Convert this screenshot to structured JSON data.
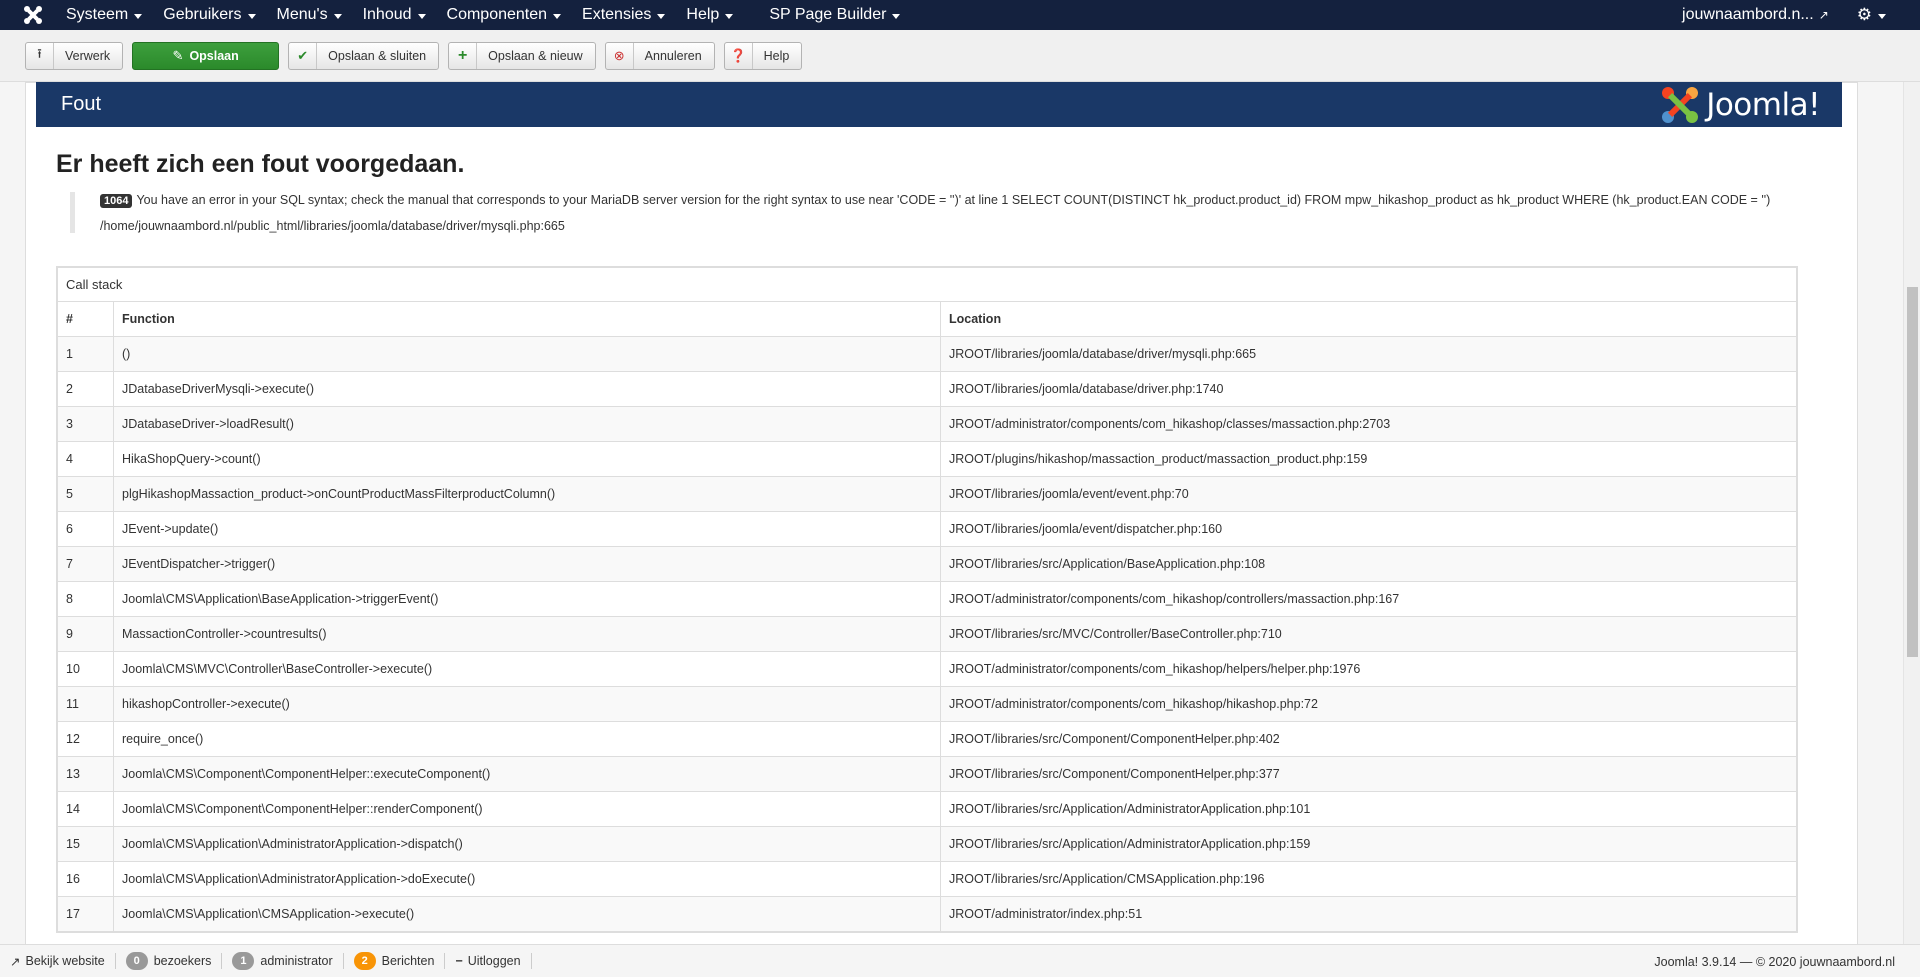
{
  "navbar": {
    "menu": [
      {
        "label": "Systeem"
      },
      {
        "label": "Gebruikers"
      },
      {
        "label": "Menu's"
      },
      {
        "label": "Inhoud"
      },
      {
        "label": "Componenten"
      },
      {
        "label": "Extensies"
      },
      {
        "label": "Help"
      },
      {
        "label": "SP Page Builder"
      }
    ],
    "site_link": "jouwnaambord.n...",
    "icons": {
      "logo": "joomla-logo-icon",
      "external": "external-link-icon",
      "settings": "gear-icon"
    }
  },
  "toolbar": {
    "buttons": [
      {
        "label": "Verwerk",
        "icon": "upload-icon"
      },
      {
        "label": "Opslaan",
        "icon": "edit-icon"
      },
      {
        "label": "Opslaan & sluiten",
        "icon": "check-icon"
      },
      {
        "label": "Opslaan & nieuw",
        "icon": "plus-icon"
      },
      {
        "label": "Annuleren",
        "icon": "cancel-icon"
      },
      {
        "label": "Help",
        "icon": "question-icon"
      }
    ],
    "colors": {
      "save_green": "#2b8a2b",
      "cancel_red": "#cc3333"
    }
  },
  "error": {
    "header_title": "Fout",
    "brand": "Joomla!",
    "heading": "Er heeft zich een fout voorgedaan.",
    "code": "1064",
    "message": "You have an error in your SQL syntax; check the manual that corresponds to your MariaDB server version for the right syntax to use near 'CODE = '')' at line 1 SELECT COUNT(DISTINCT hk_product.product_id) FROM mpw_hikashop_product as hk_product WHERE (hk_product.EAN CODE = '')",
    "path": "/home/jouwnaambord.nl/public_html/libraries/joomla/database/driver/mysqli.php:665",
    "header_color": "#1a3867"
  },
  "call_stack": {
    "caption": "Call stack",
    "headers": {
      "num": "#",
      "function": "Function",
      "location": "Location"
    },
    "rows": [
      {
        "num": "1",
        "function": "()",
        "location": "JROOT/libraries/joomla/database/driver/mysqli.php:665"
      },
      {
        "num": "2",
        "function": "JDatabaseDriverMysqli->execute()",
        "location": "JROOT/libraries/joomla/database/driver.php:1740"
      },
      {
        "num": "3",
        "function": "JDatabaseDriver->loadResult()",
        "location": "JROOT/administrator/components/com_hikashop/classes/massaction.php:2703"
      },
      {
        "num": "4",
        "function": "HikaShopQuery->count()",
        "location": "JROOT/plugins/hikashop/massaction_product/massaction_product.php:159"
      },
      {
        "num": "5",
        "function": "plgHikashopMassaction_product->onCountProductMassFilterproductColumn()",
        "location": "JROOT/libraries/joomla/event/event.php:70"
      },
      {
        "num": "6",
        "function": "JEvent->update()",
        "location": "JROOT/libraries/joomla/event/dispatcher.php:160"
      },
      {
        "num": "7",
        "function": "JEventDispatcher->trigger()",
        "location": "JROOT/libraries/src/Application/BaseApplication.php:108"
      },
      {
        "num": "8",
        "function": "Joomla\\CMS\\Application\\BaseApplication->triggerEvent()",
        "location": "JROOT/administrator/components/com_hikashop/controllers/massaction.php:167"
      },
      {
        "num": "9",
        "function": "MassactionController->countresults()",
        "location": "JROOT/libraries/src/MVC/Controller/BaseController.php:710"
      },
      {
        "num": "10",
        "function": "Joomla\\CMS\\MVC\\Controller\\BaseController->execute()",
        "location": "JROOT/administrator/components/com_hikashop/helpers/helper.php:1976"
      },
      {
        "num": "11",
        "function": "hikashopController->execute()",
        "location": "JROOT/administrator/components/com_hikashop/hikashop.php:72"
      },
      {
        "num": "12",
        "function": "require_once()",
        "location": "JROOT/libraries/src/Component/ComponentHelper.php:402"
      },
      {
        "num": "13",
        "function": "Joomla\\CMS\\Component\\ComponentHelper::executeComponent()",
        "location": "JROOT/libraries/src/Component/ComponentHelper.php:377"
      },
      {
        "num": "14",
        "function": "Joomla\\CMS\\Component\\ComponentHelper::renderComponent()",
        "location": "JROOT/libraries/src/Application/AdministratorApplication.php:101"
      },
      {
        "num": "15",
        "function": "Joomla\\CMS\\Application\\AdministratorApplication->dispatch()",
        "location": "JROOT/libraries/src/Application/AdministratorApplication.php:159"
      },
      {
        "num": "16",
        "function": "Joomla\\CMS\\Application\\AdministratorApplication->doExecute()",
        "location": "JROOT/libraries/src/Application/CMSApplication.php:196"
      },
      {
        "num": "17",
        "function": "Joomla\\CMS\\Application\\CMSApplication->execute()",
        "location": "JROOT/administrator/index.php:51"
      }
    ]
  },
  "status_bar": {
    "view_site": "Bekijk website",
    "visitors_count": "0",
    "visitors_label": "bezoekers",
    "admins_count": "1",
    "admins_label": "administrator",
    "messages_count": "2",
    "messages_label": "Berichten",
    "logout": "Uitloggen",
    "version": "Joomla! 3.9.14",
    "copyright": "— © 2020 jouwnaambord.nl"
  }
}
